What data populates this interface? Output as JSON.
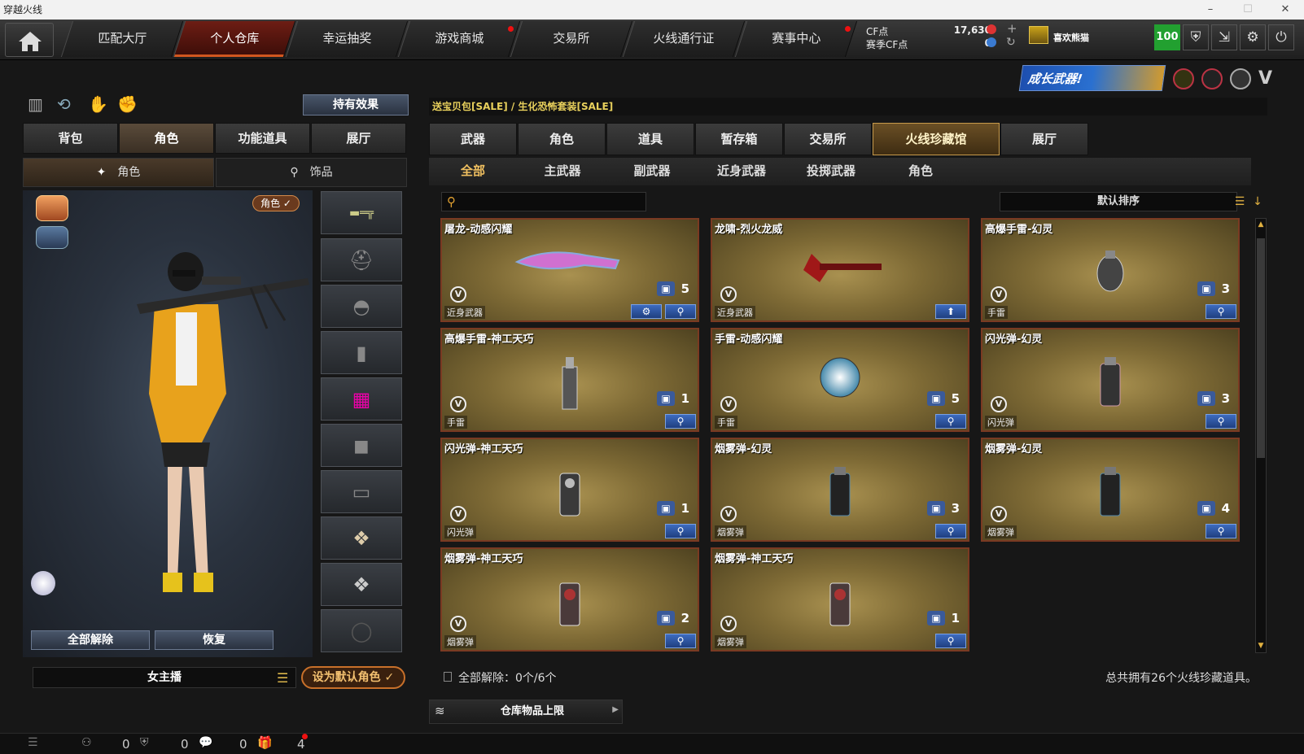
{
  "window": {
    "title": "穿越火线"
  },
  "nav": {
    "tabs": [
      {
        "label": "匹配大厅",
        "active": false,
        "dot": false
      },
      {
        "label": "个人仓库",
        "active": true,
        "dot": false
      },
      {
        "label": "幸运抽奖",
        "active": false,
        "dot": false
      },
      {
        "label": "游戏商城",
        "active": false,
        "dot": true
      },
      {
        "label": "交易所",
        "active": false,
        "dot": false
      },
      {
        "label": "火线通行证",
        "active": false,
        "dot": false
      },
      {
        "label": "赛事中心",
        "active": false,
        "dot": true
      }
    ],
    "cf_label": "CF点",
    "cf_value": "17,630",
    "event_cf_label": "赛季CF点",
    "event_cf_value": "0",
    "player_name": "喜欢熊猫",
    "level": "100"
  },
  "banner": {
    "text": "成长武器!"
  },
  "left": {
    "effects_button": "持有效果",
    "tabs": [
      "背包",
      "角色",
      "功能道具",
      "展厅"
    ],
    "active_tab": 1,
    "subtabs": [
      "角色",
      "饰品"
    ],
    "role_badge": "角色 ✓",
    "remove_all_button": "全部解除",
    "restore_button": "恢复",
    "character_name": "女主播",
    "set_default_button": "设为默认角色 ✓"
  },
  "right": {
    "marquee": "送宝贝包[SALE] / 生化恐怖套装[SALE]",
    "tabs": [
      "武器",
      "角色",
      "道具",
      "暂存箱",
      "交易所",
      "火线珍藏馆",
      "展厅"
    ],
    "active_tab": 5,
    "filters": [
      "全部",
      "主武器",
      "副武器",
      "近身武器",
      "投掷武器",
      "角色"
    ],
    "active_filter": 0,
    "search_placeholder": "",
    "sort_label": "默认排序",
    "items": [
      {
        "name": "屠龙-动感闪耀",
        "category": "近身武器",
        "count": "5",
        "extra_btn": "gear",
        "art": "knife"
      },
      {
        "name": "龙啸-烈火龙威",
        "category": "近身武器",
        "count": "",
        "extra_btn": "up",
        "art": "axe"
      },
      {
        "name": "高爆手雷-幻灵",
        "category": "手雷",
        "count": "3",
        "extra_btn": "",
        "art": "grenade"
      },
      {
        "name": "高爆手雷-神工天巧",
        "category": "手雷",
        "count": "1",
        "extra_btn": "",
        "art": "stick"
      },
      {
        "name": "手雷-动感闪耀",
        "category": "手雷",
        "count": "5",
        "extra_btn": "",
        "art": "disco"
      },
      {
        "name": "闪光弹-幻灵",
        "category": "闪光弹",
        "count": "3",
        "extra_btn": "",
        "art": "can"
      },
      {
        "name": "闪光弹-神工天巧",
        "category": "闪光弹",
        "count": "1",
        "extra_btn": "",
        "art": "can2"
      },
      {
        "name": "烟雾弹-幻灵",
        "category": "烟雾弹",
        "count": "3",
        "extra_btn": "",
        "art": "smoke"
      },
      {
        "name": "烟雾弹-幻灵",
        "category": "烟雾弹",
        "count": "4",
        "extra_btn": "",
        "art": "smoke"
      },
      {
        "name": "烟雾弹-神工天巧",
        "category": "烟雾弹",
        "count": "2",
        "extra_btn": "",
        "art": "smoke2"
      },
      {
        "name": "烟雾弹-神工天巧",
        "category": "烟雾弹",
        "count": "1",
        "extra_btn": "",
        "art": "smoke2"
      }
    ],
    "remove_all_status": "全部解除：0个/6个",
    "total_text": "总共拥有26个火线珍藏道具。",
    "storage_limit": "仓库物品上限"
  },
  "bottom": {
    "counts": [
      "0",
      "0",
      "0",
      "4"
    ]
  }
}
